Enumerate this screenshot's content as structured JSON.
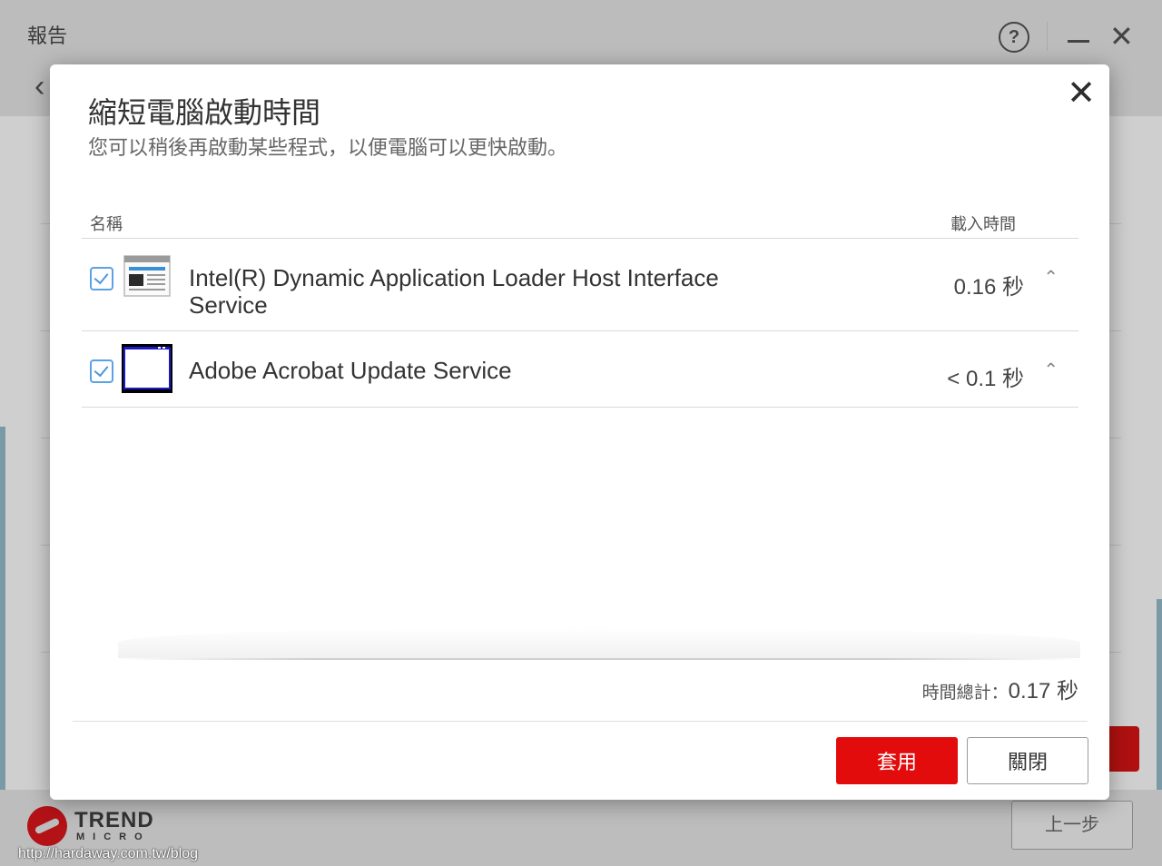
{
  "background": {
    "title": "報告",
    "help_label": "?",
    "close_glyph": "✕",
    "back_glyph": "‹",
    "prev_button": "上一步",
    "logo_word1": "TREND",
    "logo_word2": "MICRO",
    "watermark": "http://hardaway.com.tw/blog"
  },
  "dialog": {
    "title": "縮短電腦啟動時間",
    "subtitle": "您可以稍後再啟動某些程式，以便電腦可以更快啟動。",
    "close_glyph": "✕",
    "columns": {
      "name": "名稱",
      "load_time": "載入時間"
    },
    "rows": [
      {
        "name": "Intel(R) Dynamic Application Loader Host Interface Service",
        "time": "0.16 秒",
        "checked": true,
        "icon": "window-document-icon"
      },
      {
        "name": "Adobe Acrobat Update Service",
        "time": "< 0.1 秒",
        "checked": true,
        "icon": "window-blue-frame-icon"
      }
    ],
    "total_label": "時間總計：",
    "total_value": "0.17 秒",
    "apply_button": "套用",
    "close_button": "關閉",
    "accent_color": "#e30c0c",
    "checkbox_color": "#5aa2e6"
  }
}
